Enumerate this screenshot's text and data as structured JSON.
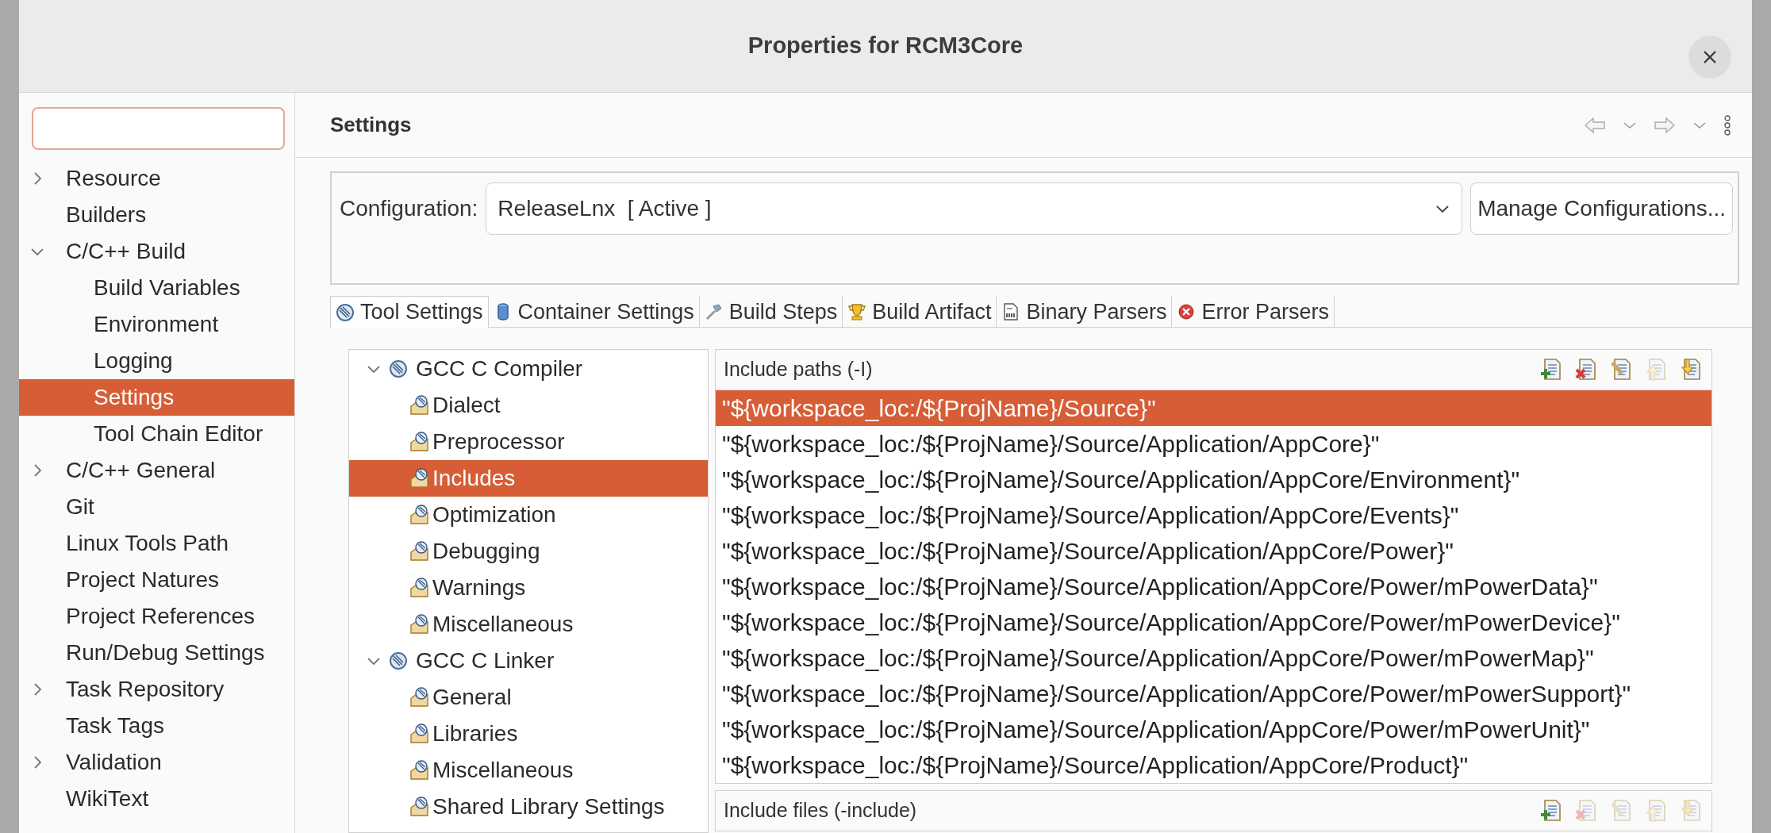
{
  "window": {
    "title": "Properties for RCM3Core"
  },
  "sidebar": {
    "items": [
      {
        "label": "Resource",
        "expanded": false,
        "selected": false
      },
      {
        "label": "Builders",
        "selected": false
      },
      {
        "label": "C/C++ Build",
        "expanded": true,
        "selected": false,
        "children": [
          {
            "label": "Build Variables",
            "selected": false
          },
          {
            "label": "Environment",
            "selected": false
          },
          {
            "label": "Logging",
            "selected": false
          },
          {
            "label": "Settings",
            "selected": true
          },
          {
            "label": "Tool Chain Editor",
            "selected": false
          }
        ]
      },
      {
        "label": "C/C++ General",
        "expanded": false,
        "selected": false
      },
      {
        "label": "Git",
        "selected": false
      },
      {
        "label": "Linux Tools Path",
        "selected": false
      },
      {
        "label": "Project Natures",
        "selected": false
      },
      {
        "label": "Project References",
        "selected": false
      },
      {
        "label": "Run/Debug Settings",
        "selected": false
      },
      {
        "label": "Task Repository",
        "expanded": false,
        "selected": false
      },
      {
        "label": "Task Tags",
        "selected": false
      },
      {
        "label": "Validation",
        "expanded": false,
        "selected": false
      },
      {
        "label": "WikiText",
        "selected": false
      }
    ]
  },
  "page": {
    "title": "Settings"
  },
  "configuration": {
    "label": "Configuration:",
    "value": "ReleaseLnx  [ Active ]",
    "button": "Manage Configurations..."
  },
  "tabs": [
    {
      "label": "Tool Settings",
      "selected": true
    },
    {
      "label": "Container Settings",
      "selected": false
    },
    {
      "label": "Build Steps",
      "selected": false
    },
    {
      "label": "Build Artifact",
      "selected": false
    },
    {
      "label": "Binary Parsers",
      "selected": false
    },
    {
      "label": "Error Parsers",
      "selected": false
    }
  ],
  "tool_tree": [
    {
      "label": "GCC C Compiler",
      "expanded": true,
      "selected": false,
      "children": [
        {
          "label": "Dialect",
          "selected": false
        },
        {
          "label": "Preprocessor",
          "selected": false
        },
        {
          "label": "Includes",
          "selected": true
        },
        {
          "label": "Optimization",
          "selected": false
        },
        {
          "label": "Debugging",
          "selected": false
        },
        {
          "label": "Warnings",
          "selected": false
        },
        {
          "label": "Miscellaneous",
          "selected": false
        }
      ]
    },
    {
      "label": "GCC C Linker",
      "expanded": true,
      "selected": false,
      "children": [
        {
          "label": "General",
          "selected": false
        },
        {
          "label": "Libraries",
          "selected": false
        },
        {
          "label": "Miscellaneous",
          "selected": false
        },
        {
          "label": "Shared Library Settings",
          "selected": false
        }
      ]
    }
  ],
  "include_paths": {
    "title": "Include paths (-I)",
    "toolbar": [
      {
        "kind": "add",
        "disabled": false
      },
      {
        "kind": "delete",
        "disabled": false
      },
      {
        "kind": "edit",
        "disabled": false
      },
      {
        "kind": "up",
        "disabled": true
      },
      {
        "kind": "down",
        "disabled": false
      }
    ],
    "items": [
      {
        "text": "\"${workspace_loc:/${ProjName}/Source}\"",
        "selected": true
      },
      {
        "text": "\"${workspace_loc:/${ProjName}/Source/Application/AppCore}\"",
        "selected": false
      },
      {
        "text": "\"${workspace_loc:/${ProjName}/Source/Application/AppCore/Environment}\"",
        "selected": false
      },
      {
        "text": "\"${workspace_loc:/${ProjName}/Source/Application/AppCore/Events}\"",
        "selected": false
      },
      {
        "text": "\"${workspace_loc:/${ProjName}/Source/Application/AppCore/Power}\"",
        "selected": false
      },
      {
        "text": "\"${workspace_loc:/${ProjName}/Source/Application/AppCore/Power/mPowerData}\"",
        "selected": false
      },
      {
        "text": "\"${workspace_loc:/${ProjName}/Source/Application/AppCore/Power/mPowerDevice}\"",
        "selected": false
      },
      {
        "text": "\"${workspace_loc:/${ProjName}/Source/Application/AppCore/Power/mPowerMap}\"",
        "selected": false
      },
      {
        "text": "\"${workspace_loc:/${ProjName}/Source/Application/AppCore/Power/mPowerSupport}\"",
        "selected": false
      },
      {
        "text": "\"${workspace_loc:/${ProjName}/Source/Application/AppCore/Power/mPowerUnit}\"",
        "selected": false
      },
      {
        "text": "\"${workspace_loc:/${ProjName}/Source/Application/AppCore/Product}\"",
        "selected": false
      }
    ]
  },
  "include_files": {
    "title": "Include files (-include)",
    "toolbar": [
      {
        "kind": "add",
        "disabled": false
      },
      {
        "kind": "delete",
        "disabled": true
      },
      {
        "kind": "edit",
        "disabled": true
      },
      {
        "kind": "up",
        "disabled": true
      },
      {
        "kind": "down",
        "disabled": true
      }
    ]
  }
}
